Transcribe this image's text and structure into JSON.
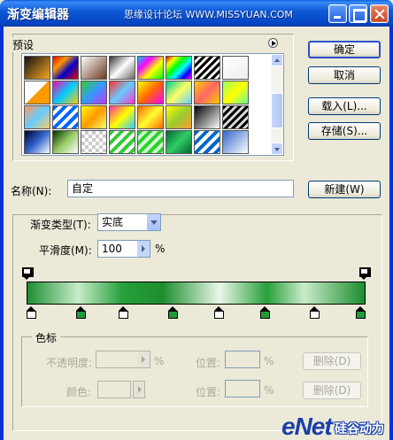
{
  "window": {
    "title": "渐变编辑器",
    "watermark": "思缘设计论坛 WWW.MISSYUAN.COM"
  },
  "presets": {
    "label": "预设",
    "swatches": [
      {
        "bg": "linear-gradient(135deg,#111 0%,#f5a623 100%)"
      },
      {
        "bg": "linear-gradient(135deg,#e00 0%,#f90 30%,#00c 60%,#e00 100%)"
      },
      {
        "bg": "linear-gradient(135deg,#fff 0%,#6b3a1f 100%)"
      },
      {
        "bg": "linear-gradient(135deg,#333 0%,#fff 50%,#666 100%)"
      },
      {
        "bg": "linear-gradient(135deg,#0cf 0%,#f0f 30%,#ff0 60%,#0f0 100%)"
      },
      {
        "bg": "linear-gradient(135deg,#e00 0%,#ff0 20%,#0f0 40%,#0ff 60%,#00f 80%,#f0f 100%)"
      },
      {
        "bg": "repeating-linear-gradient(135deg,#000 0 3px,#fff 3px 6px)"
      },
      {
        "bg": "linear-gradient(135deg,#fff 0%,#eee 100%)"
      },
      {
        "bg": "linear-gradient(135deg,#fff 0%,#fff 50%,#f90 50%,#f90 100%)"
      },
      {
        "bg": "linear-gradient(135deg,#f0a 0%,#0cf 50%,#fc0 100%)"
      },
      {
        "bg": "linear-gradient(135deg,#3c3 0%,#39f 50%,#c3f 100%)"
      },
      {
        "bg": "linear-gradient(135deg,#f33 0%,#6cf 50%,#f3c 100%)"
      },
      {
        "bg": "linear-gradient(135deg,#ff0 0%,#f60 50%,#f0f 100%)"
      },
      {
        "bg": "linear-gradient(135deg,#0c9 0%,#ff6 50%,#6cf 100%)"
      },
      {
        "bg": "linear-gradient(135deg,#fc0 0%,#f66 50%,#fc0 100%)"
      },
      {
        "bg": "linear-gradient(135deg,#9f6 0%,#ff0 50%,#6f9 100%)"
      },
      {
        "bg": "linear-gradient(135deg,#f96 0%,#6cf 50%,#fc6 100%)"
      },
      {
        "bg": "repeating-linear-gradient(135deg,#06f 0 4px,#fff 4px 8px)"
      },
      {
        "bg": "linear-gradient(135deg,#ff0 0%,#f90 50%,#ff6 100%)"
      },
      {
        "bg": "linear-gradient(135deg,#f39 0%,#ff0 50%,#3cf 100%)"
      },
      {
        "bg": "linear-gradient(135deg,#f60 0%,#ff3 50%,#f60 100%)"
      },
      {
        "bg": "linear-gradient(135deg,#ff0 0%,#9c3 50%,#f93 100%)"
      },
      {
        "bg": "linear-gradient(135deg,#000 0%,#fff 100%)"
      },
      {
        "bg": "repeating-linear-gradient(135deg,#000 0 3px,#ddd 3px 6px)"
      },
      {
        "bg": "linear-gradient(135deg,#003 0%,#36c 50%,#fff 100%)"
      },
      {
        "bg": "linear-gradient(135deg,#030 0%,#9c6 50%,#fff 100%)"
      },
      {
        "bg": "repeating-conic-gradient(#ccc 0 25%,#fff 0 50%) 0 0/8px 8px"
      },
      {
        "bg": "repeating-linear-gradient(135deg,#3c3 0 4px,#fff 4px 8px)"
      },
      {
        "bg": "repeating-linear-gradient(135deg,#3c3 0 4px,#cfc 4px 8px)"
      },
      {
        "bg": "linear-gradient(135deg,#063 0%,#3c6 50%,#063 100%)"
      },
      {
        "bg": "repeating-linear-gradient(135deg,#06c 0 4px,#fff 4px 8px)"
      },
      {
        "bg": "linear-gradient(135deg,#36c 0%,#fff 100%)"
      }
    ]
  },
  "buttons": {
    "ok": "确定",
    "cancel": "取消",
    "load": "载入(L)...",
    "save": "存储(S)...",
    "new": "新建(W)"
  },
  "name": {
    "label": "名称(N):",
    "value": "自定"
  },
  "gradient": {
    "type_label": "渐变类型(T):",
    "type_value": "实底",
    "smoothness_label": "平滑度(M):",
    "smoothness_value": "100",
    "smoothness_unit": "%"
  },
  "color_stops": {
    "group_label": "色标",
    "opacity_label": "不透明度:",
    "opacity_unit": "%",
    "opacity_location_label": "位置:",
    "opacity_location_unit": "%",
    "opacity_delete": "删除(D)",
    "color_label": "颜色:",
    "color_location_label": "位置:",
    "color_location_unit": "%",
    "color_delete": "删除(D)"
  },
  "gradient_stops": {
    "opacity": [
      0,
      1
    ],
    "color": [
      {
        "pos": 0.0,
        "color": "#ffffff"
      },
      {
        "pos": 0.15,
        "color": "#1f9b3a"
      },
      {
        "pos": 0.28,
        "color": "#ffffff"
      },
      {
        "pos": 0.43,
        "color": "#1f9b3a"
      },
      {
        "pos": 0.57,
        "color": "#ffffff"
      },
      {
        "pos": 0.71,
        "color": "#1f9b3a"
      },
      {
        "pos": 0.86,
        "color": "#ffffff"
      },
      {
        "pos": 1.0,
        "color": "#1f9b3a"
      }
    ]
  },
  "logo": {
    "text": "eNet",
    "cn": "硅谷动力"
  }
}
